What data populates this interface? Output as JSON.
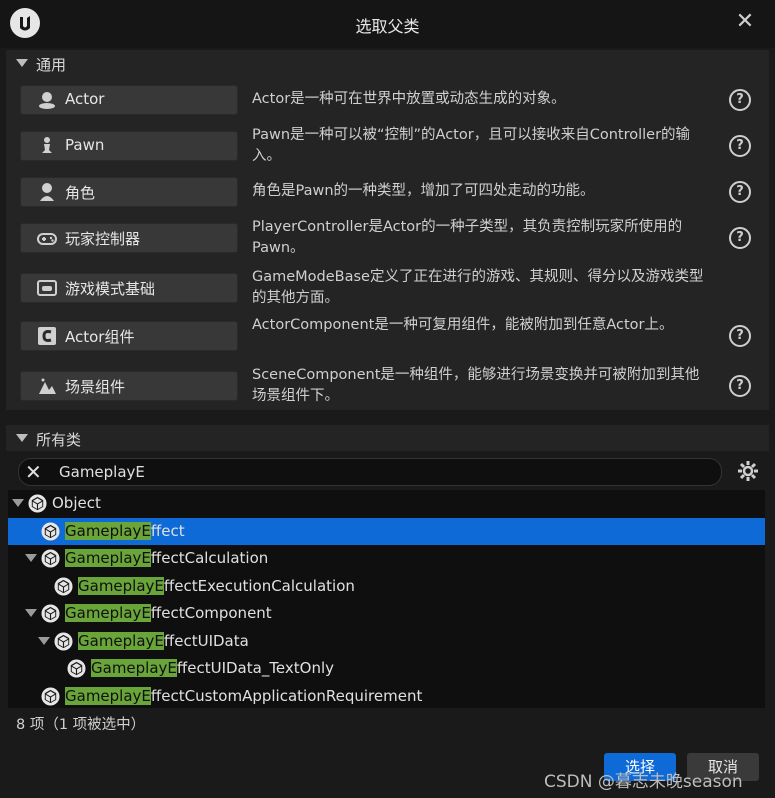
{
  "window": {
    "title": "选取父类"
  },
  "common_section": {
    "label": "通用",
    "classes": [
      {
        "label": "Actor",
        "icon": "actor-icon",
        "desc": "Actor是一种可在世界中放置或动态生成的对象。"
      },
      {
        "label": "Pawn",
        "icon": "pawn-icon",
        "desc": "Pawn是一种可以被“控制”的Actor，且可以接收来自Controller的输入。"
      },
      {
        "label": "角色",
        "icon": "character-icon",
        "desc": "角色是Pawn的一种类型，增加了可四处走动的功能。"
      },
      {
        "label": "玩家控制器",
        "icon": "gamepad-icon",
        "desc": "PlayerController是Actor的一种子类型，其负责控制玩家所使用的Pawn。"
      },
      {
        "label": "游戏模式基础",
        "icon": "game-mode-icon",
        "desc": "GameModeBase定义了正在进行的游戏、其规则、得分以及游戏类型的其他方面。"
      },
      {
        "label": "Actor组件",
        "icon": "actor-component-icon",
        "desc": "ActorComponent是一种可复用组件，能被附加到任意Actor上。"
      },
      {
        "label": "场景组件",
        "icon": "scene-component-icon",
        "desc": "SceneComponent是一种组件，能够进行场景变换并可被附加到其他场景组件下。"
      }
    ]
  },
  "all_classes_section": {
    "label": "所有类",
    "search_value": "GameplayE",
    "tree": [
      {
        "prefix": "",
        "rest": "Object",
        "depth": 0,
        "expanded": true,
        "selected": false
      },
      {
        "prefix": "GameplayE",
        "rest": "ffect",
        "depth": 1,
        "expanded": false,
        "selected": true
      },
      {
        "prefix": "GameplayE",
        "rest": "ffectCalculation",
        "depth": 1,
        "expanded": true,
        "selected": false
      },
      {
        "prefix": "GameplayE",
        "rest": "ffectExecutionCalculation",
        "depth": 2,
        "expanded": false,
        "selected": false
      },
      {
        "prefix": "GameplayE",
        "rest": "ffectComponent",
        "depth": 1,
        "expanded": true,
        "selected": false
      },
      {
        "prefix": "GameplayE",
        "rest": "ffectUIData",
        "depth": 2,
        "expanded": true,
        "selected": false
      },
      {
        "prefix": "GameplayE",
        "rest": "ffectUIData_TextOnly",
        "depth": 3,
        "expanded": false,
        "selected": false
      },
      {
        "prefix": "GameplayE",
        "rest": "ffectCustomApplicationRequirement",
        "depth": 1,
        "expanded": false,
        "selected": false
      }
    ],
    "status": "8 项（1 项被选中）"
  },
  "footer": {
    "select_label": "选择",
    "cancel_label": "取消"
  },
  "watermark": "CSDN @暮志未晚season",
  "colors": {
    "accent": "#0e6ad6",
    "highlight": "#6aa53a",
    "background": "#1a1a1a"
  }
}
